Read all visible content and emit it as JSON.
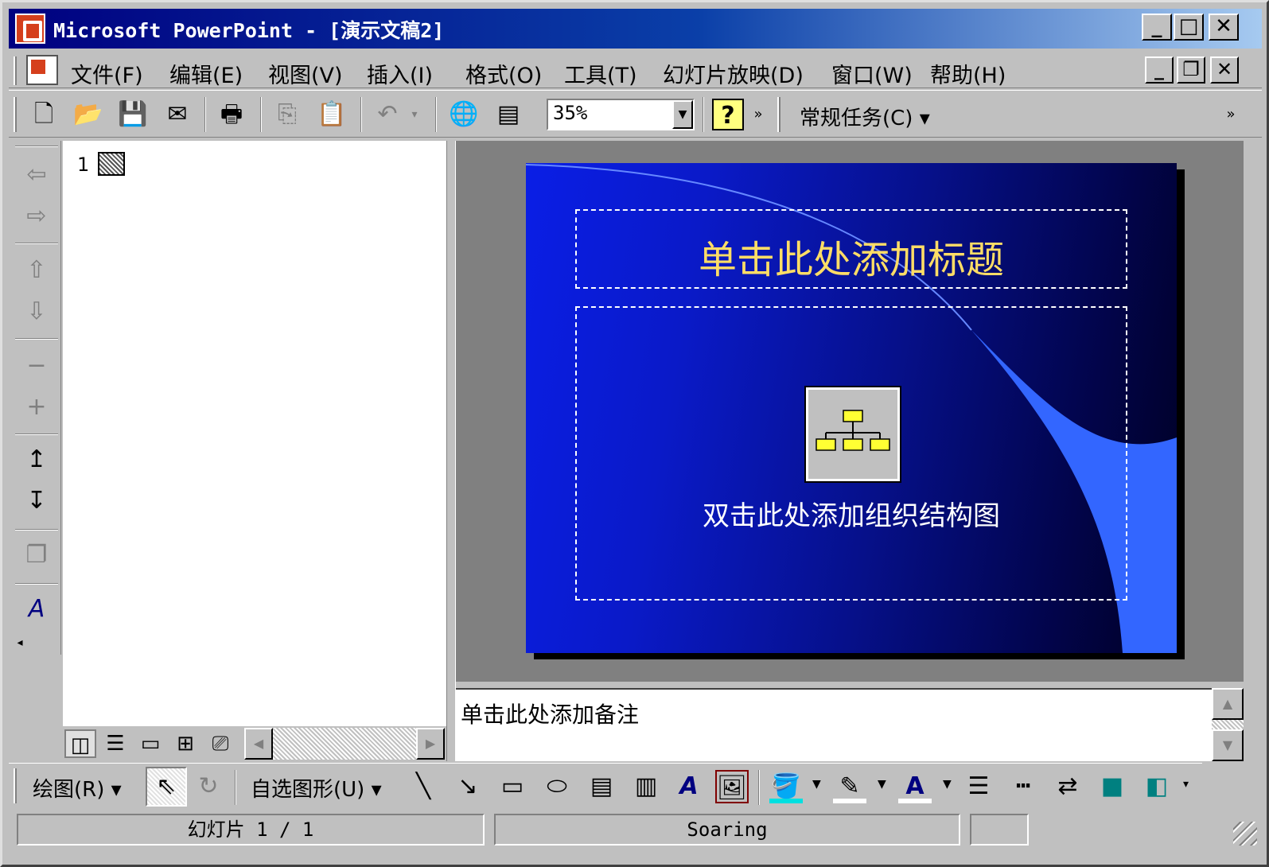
{
  "window": {
    "title": "Microsoft PowerPoint - [演示文稿2]",
    "controls": {
      "minimize": "_",
      "maximize": "□",
      "close": "✕"
    }
  },
  "menubar": {
    "items": [
      "文件(F)",
      "编辑(E)",
      "视图(V)",
      "插入(I)",
      "格式(O)",
      "工具(T)",
      "幻灯片放映(D)",
      "窗口(W)",
      "帮助(H)"
    ],
    "doc_controls": {
      "minimize": "_",
      "restore": "❐",
      "close": "✕"
    }
  },
  "toolbar": {
    "zoom_value": "35%",
    "task_pane_label": "常规任务(C) ▾",
    "icons": [
      "new-icon",
      "open-icon",
      "save-icon",
      "email-icon",
      "print-icon",
      "copy-icon",
      "paste-icon",
      "undo-icon",
      "hyperlink-icon",
      "insert-chart-icon",
      "help-icon"
    ]
  },
  "outline": {
    "slide_number": "1"
  },
  "slide": {
    "title_placeholder": "单击此处添加标题",
    "body_placeholder": "双击此处添加组织结构图",
    "colors": {
      "title_text": "#ffdd66",
      "background_start": "#0a1ee6",
      "background_end": "#000022",
      "swoosh": "#3366ff"
    }
  },
  "notes": {
    "placeholder": "单击此处添加备注"
  },
  "drawbar": {
    "draw_label": "绘图(R) ▾",
    "autoshapes_label": "自选图形(U) ▾"
  },
  "statusbar": {
    "slide_position": "幻灯片 1 / 1",
    "design_template": "Soaring",
    "language": ""
  }
}
